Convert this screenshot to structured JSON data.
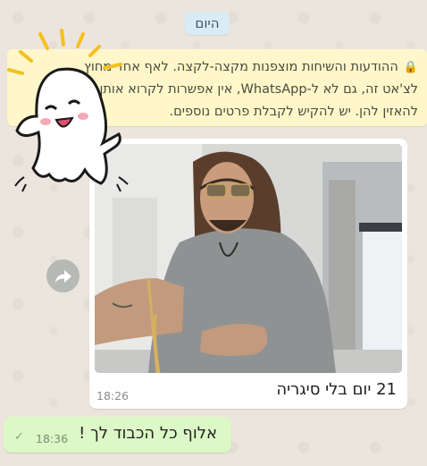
{
  "chat": {
    "date_chip": "היום",
    "encryption_notice": {
      "line1": "ההודעות והשיחות מוצפנות מקצה-לקצה. לאף אחד מחוץ",
      "line2": "לצ'אט זה, גם לא ל-WhatsApp, אין אפשרות לקרוא אותן או",
      "line3": "להאזין להן. יש להקיש לקבלת פרטים נוספים."
    },
    "image_message": {
      "caption": "21 יום בלי סיגריה",
      "time": "18:26"
    },
    "reply_message": {
      "text": "אלוף כל הכבוד לך !",
      "time": "18:36",
      "status_icon": "single-check-icon"
    }
  },
  "colors": {
    "chat_background": "#ece5dd",
    "notice_background": "#fff7c9",
    "outgoing_bubble": "#dcf8c6",
    "date_chip_background": "#d9ecf6"
  }
}
